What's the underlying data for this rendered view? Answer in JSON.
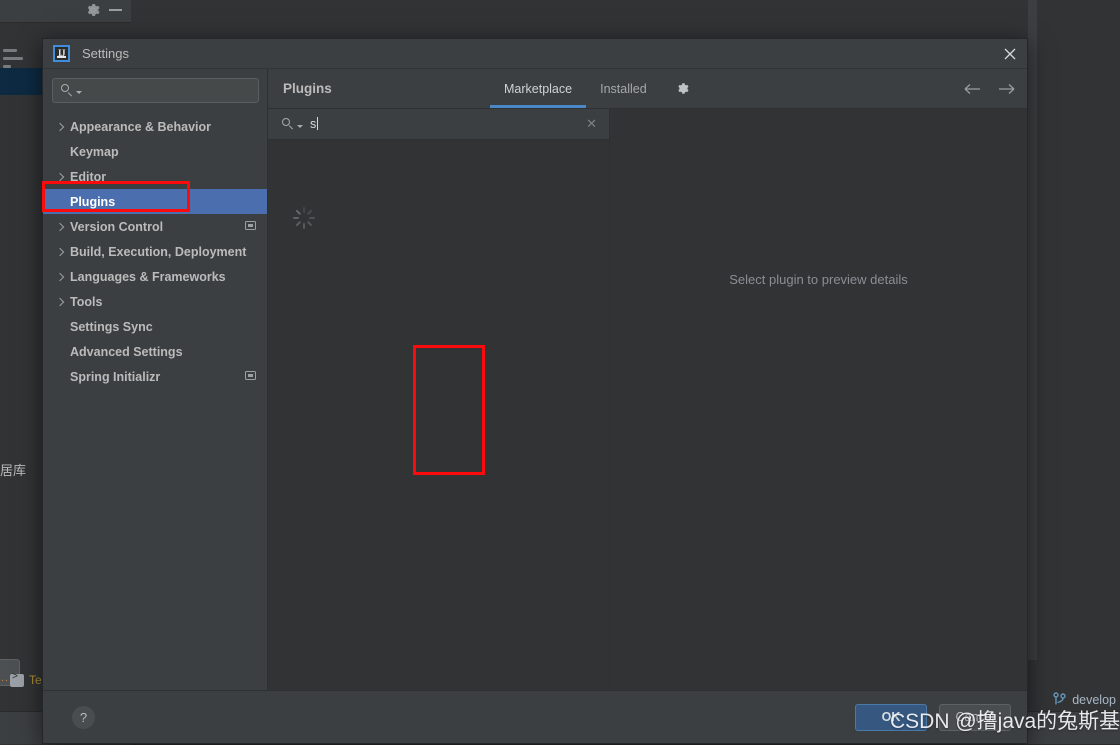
{
  "background": {
    "database_label": "居库",
    "terminal_label": "Ter",
    "branch_label": "develop",
    "branch_icon": "git-branch-icon",
    "gear_icon": "gear-icon",
    "minimize_icon": "minimize-icon",
    "ellipsis_label": "..."
  },
  "dialog": {
    "title": "Settings",
    "logo_text": "IJ",
    "close_icon": "close-icon"
  },
  "nav": {
    "search_placeholder": "",
    "search_value": "",
    "search_icon": "search-icon",
    "items": [
      {
        "label": "Appearance & Behavior",
        "expandable": true,
        "selected": false,
        "badge": false
      },
      {
        "label": "Keymap",
        "expandable": false,
        "selected": false,
        "badge": false
      },
      {
        "label": "Editor",
        "expandable": true,
        "selected": false,
        "badge": false
      },
      {
        "label": "Plugins",
        "expandable": false,
        "selected": true,
        "badge": false
      },
      {
        "label": "Version Control",
        "expandable": true,
        "selected": false,
        "badge": true
      },
      {
        "label": "Build, Execution, Deployment",
        "expandable": true,
        "selected": false,
        "badge": false
      },
      {
        "label": "Languages & Frameworks",
        "expandable": true,
        "selected": false,
        "badge": false
      },
      {
        "label": "Tools",
        "expandable": true,
        "selected": false,
        "badge": false
      },
      {
        "label": "Settings Sync",
        "expandable": false,
        "selected": false,
        "badge": false
      },
      {
        "label": "Advanced Settings",
        "expandable": false,
        "selected": false,
        "badge": false
      },
      {
        "label": "Spring Initializr",
        "expandable": false,
        "selected": false,
        "badge": true
      }
    ]
  },
  "plugins": {
    "title": "Plugins",
    "tabs": [
      {
        "label": "Marketplace",
        "active": true
      },
      {
        "label": "Installed",
        "active": false
      }
    ],
    "gear_icon": "gear-icon",
    "back_icon": "arrow-left-icon",
    "forward_icon": "arrow-right-icon",
    "search_value": "s",
    "search_icon": "search-icon",
    "clear_label": "✕",
    "loading_state": "loading-spinner",
    "detail_placeholder": "Select plugin to preview details"
  },
  "footer": {
    "help_label": "?",
    "ok_label": "OK",
    "cancel_label": "Cancel"
  },
  "annotations": {
    "highlight_color": "#fb0b0b",
    "watermark": "CSDN @撸java的兔斯基"
  }
}
